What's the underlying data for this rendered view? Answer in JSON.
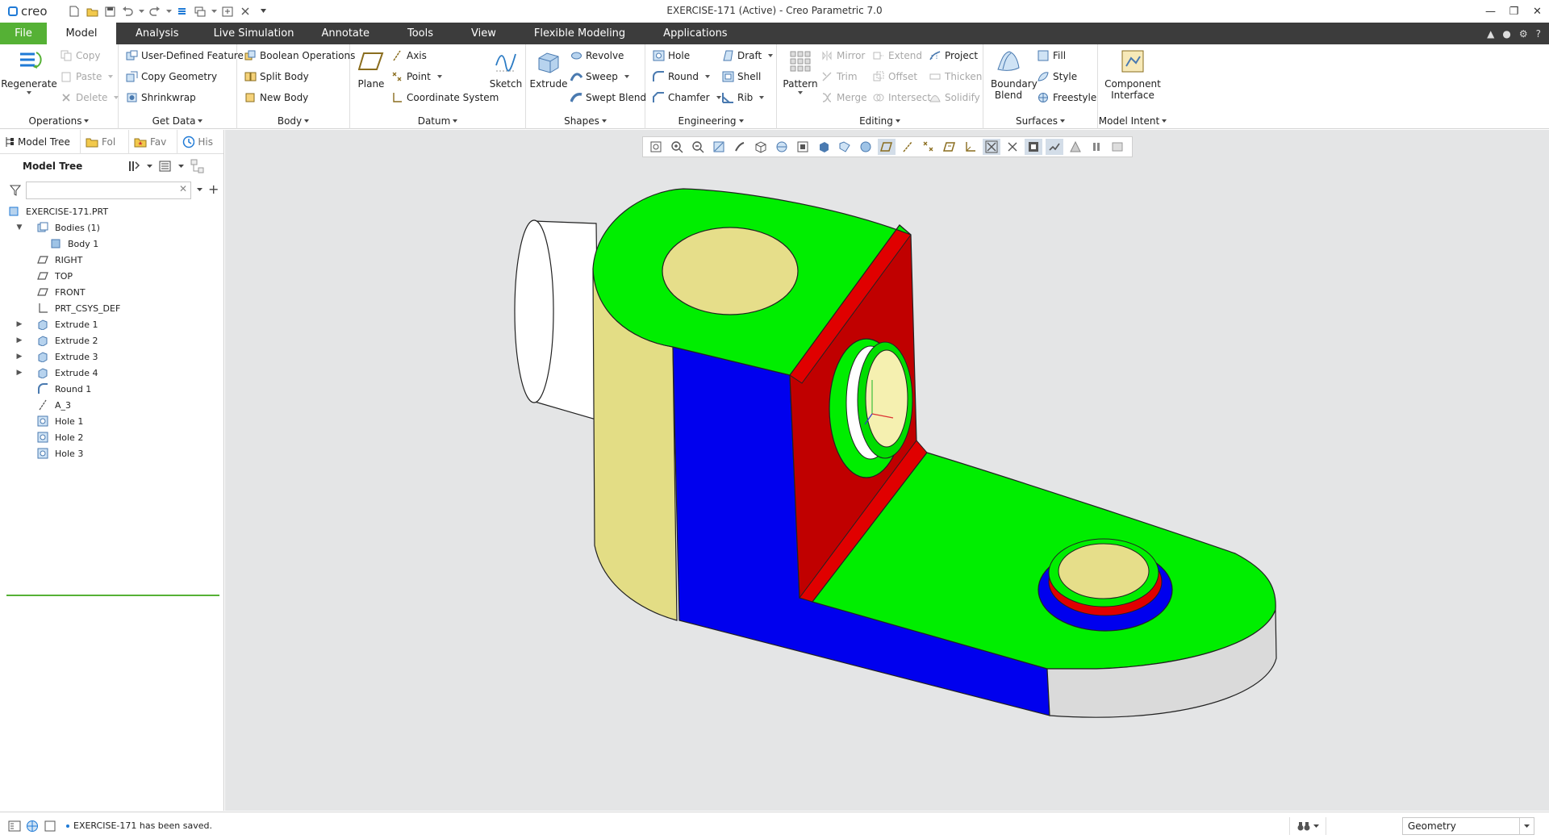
{
  "app": {
    "logo": "creo",
    "window_title": "EXERCISE-171 (Active) - Creo Parametric 7.0"
  },
  "menu_tabs": [
    "File",
    "Model",
    "Analysis",
    "Live Simulation",
    "Annotate",
    "Tools",
    "View",
    "Flexible Modeling",
    "Applications"
  ],
  "ribbon": {
    "operations": {
      "label": "Operations",
      "regenerate": "Regenerate",
      "copy": "Copy",
      "paste": "Paste",
      "delete": "Delete"
    },
    "get_data": {
      "label": "Get Data",
      "udf": "User-Defined Feature",
      "copy_geometry": "Copy Geometry",
      "shrinkwrap": "Shrinkwrap"
    },
    "body": {
      "label": "Body",
      "boolean": "Boolean Operations",
      "split": "Split Body",
      "new": "New Body"
    },
    "datum": {
      "label": "Datum",
      "plane": "Plane",
      "axis": "Axis",
      "point": "Point",
      "csys": "Coordinate System",
      "sketch": "Sketch"
    },
    "shapes": {
      "label": "Shapes",
      "extrude": "Extrude",
      "revolve": "Revolve",
      "sweep": "Sweep",
      "swept_blend": "Swept Blend"
    },
    "engineering": {
      "label": "Engineering",
      "hole": "Hole",
      "round": "Round",
      "chamfer": "Chamfer",
      "draft": "Draft",
      "shell": "Shell",
      "rib": "Rib"
    },
    "editing": {
      "label": "Editing",
      "pattern": "Pattern",
      "mirror": "Mirror",
      "trim": "Trim",
      "merge": "Merge",
      "extend": "Extend",
      "offset": "Offset",
      "intersect": "Intersect",
      "project": "Project",
      "thicken": "Thicken",
      "solidify": "Solidify"
    },
    "surfaces": {
      "label": "Surfaces",
      "boundary_blend": "Boundary Blend",
      "fill": "Fill",
      "style": "Style",
      "freestyle": "Freestyle"
    },
    "model_intent": {
      "label": "Model Intent",
      "component_interface": "Component Interface"
    }
  },
  "navigator": {
    "tabs": [
      "Model Tree",
      "Folder Browser",
      "Favorites",
      "History"
    ],
    "tabs_visible": [
      "Model Tree",
      "Fol",
      "Fav",
      "His"
    ],
    "title": "Model Tree",
    "search_value": "",
    "tree": [
      {
        "label": "EXERCISE-171.PRT",
        "depth": 0,
        "icon": "part-icon",
        "expander": ""
      },
      {
        "label": "Bodies (1)",
        "depth": 1,
        "icon": "bodies-icon",
        "expander": "open"
      },
      {
        "label": "Body 1",
        "depth": 2,
        "icon": "body-icon",
        "expander": ""
      },
      {
        "label": "RIGHT",
        "depth": 1,
        "icon": "datum-plane-icon",
        "expander": ""
      },
      {
        "label": "TOP",
        "depth": 1,
        "icon": "datum-plane-icon",
        "expander": ""
      },
      {
        "label": "FRONT",
        "depth": 1,
        "icon": "datum-plane-icon",
        "expander": ""
      },
      {
        "label": "PRT_CSYS_DEF",
        "depth": 1,
        "icon": "csys-icon",
        "expander": ""
      },
      {
        "label": "Extrude 1",
        "depth": 1,
        "icon": "extrude-icon",
        "expander": "closed"
      },
      {
        "label": "Extrude 2",
        "depth": 1,
        "icon": "extrude-icon",
        "expander": "closed"
      },
      {
        "label": "Extrude 3",
        "depth": 1,
        "icon": "extrude-icon",
        "expander": "closed"
      },
      {
        "label": "Extrude 4",
        "depth": 1,
        "icon": "extrude-icon",
        "expander": "closed"
      },
      {
        "label": "Round 1",
        "depth": 1,
        "icon": "round-icon",
        "expander": ""
      },
      {
        "label": "A_3",
        "depth": 1,
        "icon": "axis-icon",
        "expander": ""
      },
      {
        "label": "Hole 1",
        "depth": 1,
        "icon": "hole-icon",
        "expander": ""
      },
      {
        "label": "Hole 2",
        "depth": 1,
        "icon": "hole-icon",
        "expander": ""
      },
      {
        "label": "Hole 3",
        "depth": 1,
        "icon": "hole-icon",
        "expander": ""
      }
    ]
  },
  "status_bar": {
    "message": "EXERCISE-171 has been saved.",
    "filter": "Geometry"
  },
  "colors": {
    "accent_green": "#55b135",
    "tab_bar": "#3c3c3c",
    "viewport_bg": "#e4e5e6",
    "face_green": "#00ee00",
    "face_blue": "#0000ee",
    "face_red": "#c80000",
    "face_yellow": "#e3dd85"
  }
}
